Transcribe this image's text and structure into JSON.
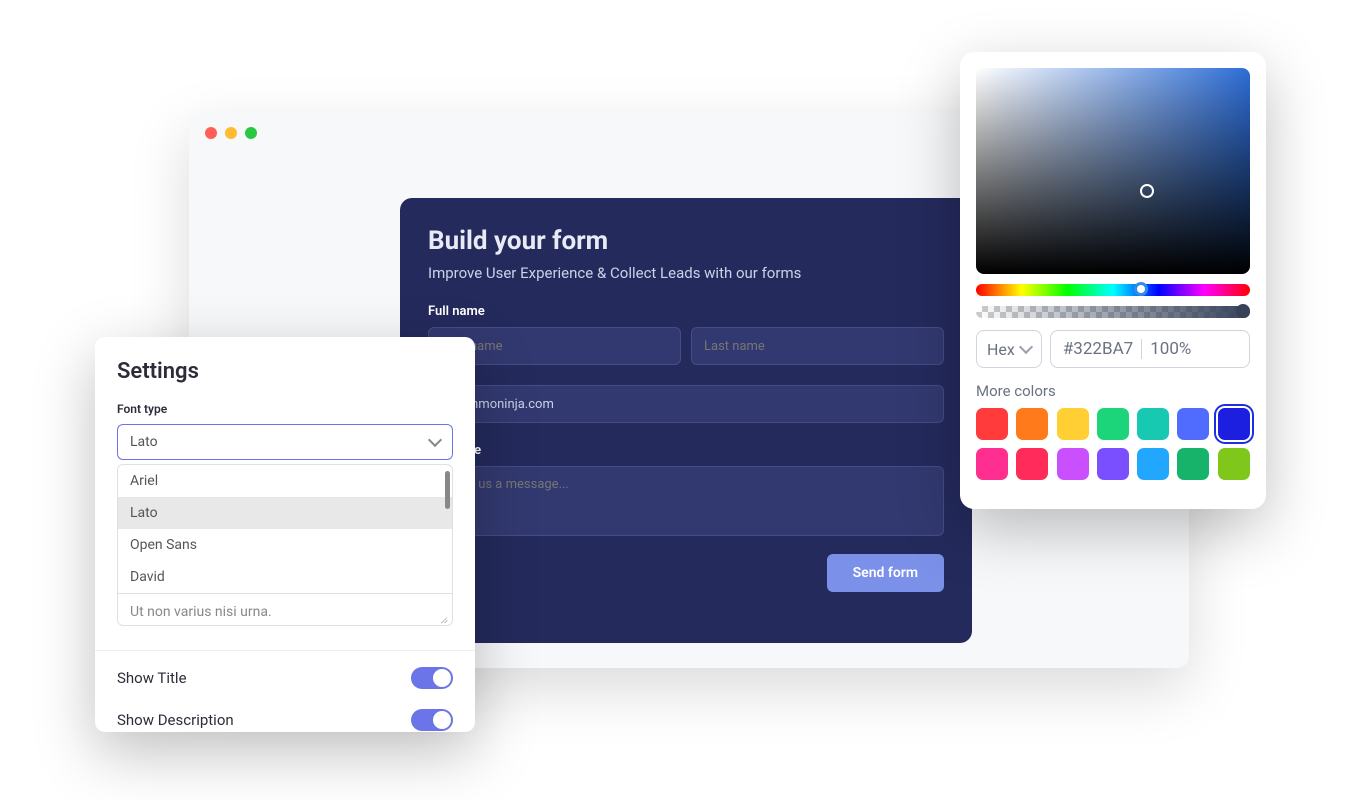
{
  "form": {
    "title": "Build your form",
    "subtitle": "Improve User Experience & Collect Leads with our forms",
    "full_name_label": "Full name",
    "first_name_placeholder": "First name",
    "last_name_placeholder": "Last name",
    "email_value": "@commoninja.com",
    "message_label": "Message",
    "message_placeholder": "Leave us a message...",
    "send_label": "Send form"
  },
  "settings": {
    "title": "Settings",
    "font_type_label": "Font type",
    "font_select_value": "Lato",
    "font_options": [
      "Ariel",
      "Lato",
      "Open Sans",
      "David"
    ],
    "lorem_text": "Ut non varius nisi urna.",
    "show_title_label": "Show Title",
    "show_description_label": "Show Description",
    "show_title_on": true,
    "show_description_on": true
  },
  "color_picker": {
    "format_label": "Hex",
    "hex_value": "#322BA7",
    "alpha_value": "100%",
    "more_colors_label": "More colors",
    "swatches": [
      "#ff3b3b",
      "#ff7a1a",
      "#ffcf33",
      "#1cd47a",
      "#18c9b2",
      "#4f6cff",
      "#1c1fe0",
      "#ff2f92",
      "#ff2b5a",
      "#c94fff",
      "#7a4fff",
      "#22a7ff",
      "#17b36a",
      "#7fc71a"
    ],
    "selected_swatch_index": 6
  }
}
